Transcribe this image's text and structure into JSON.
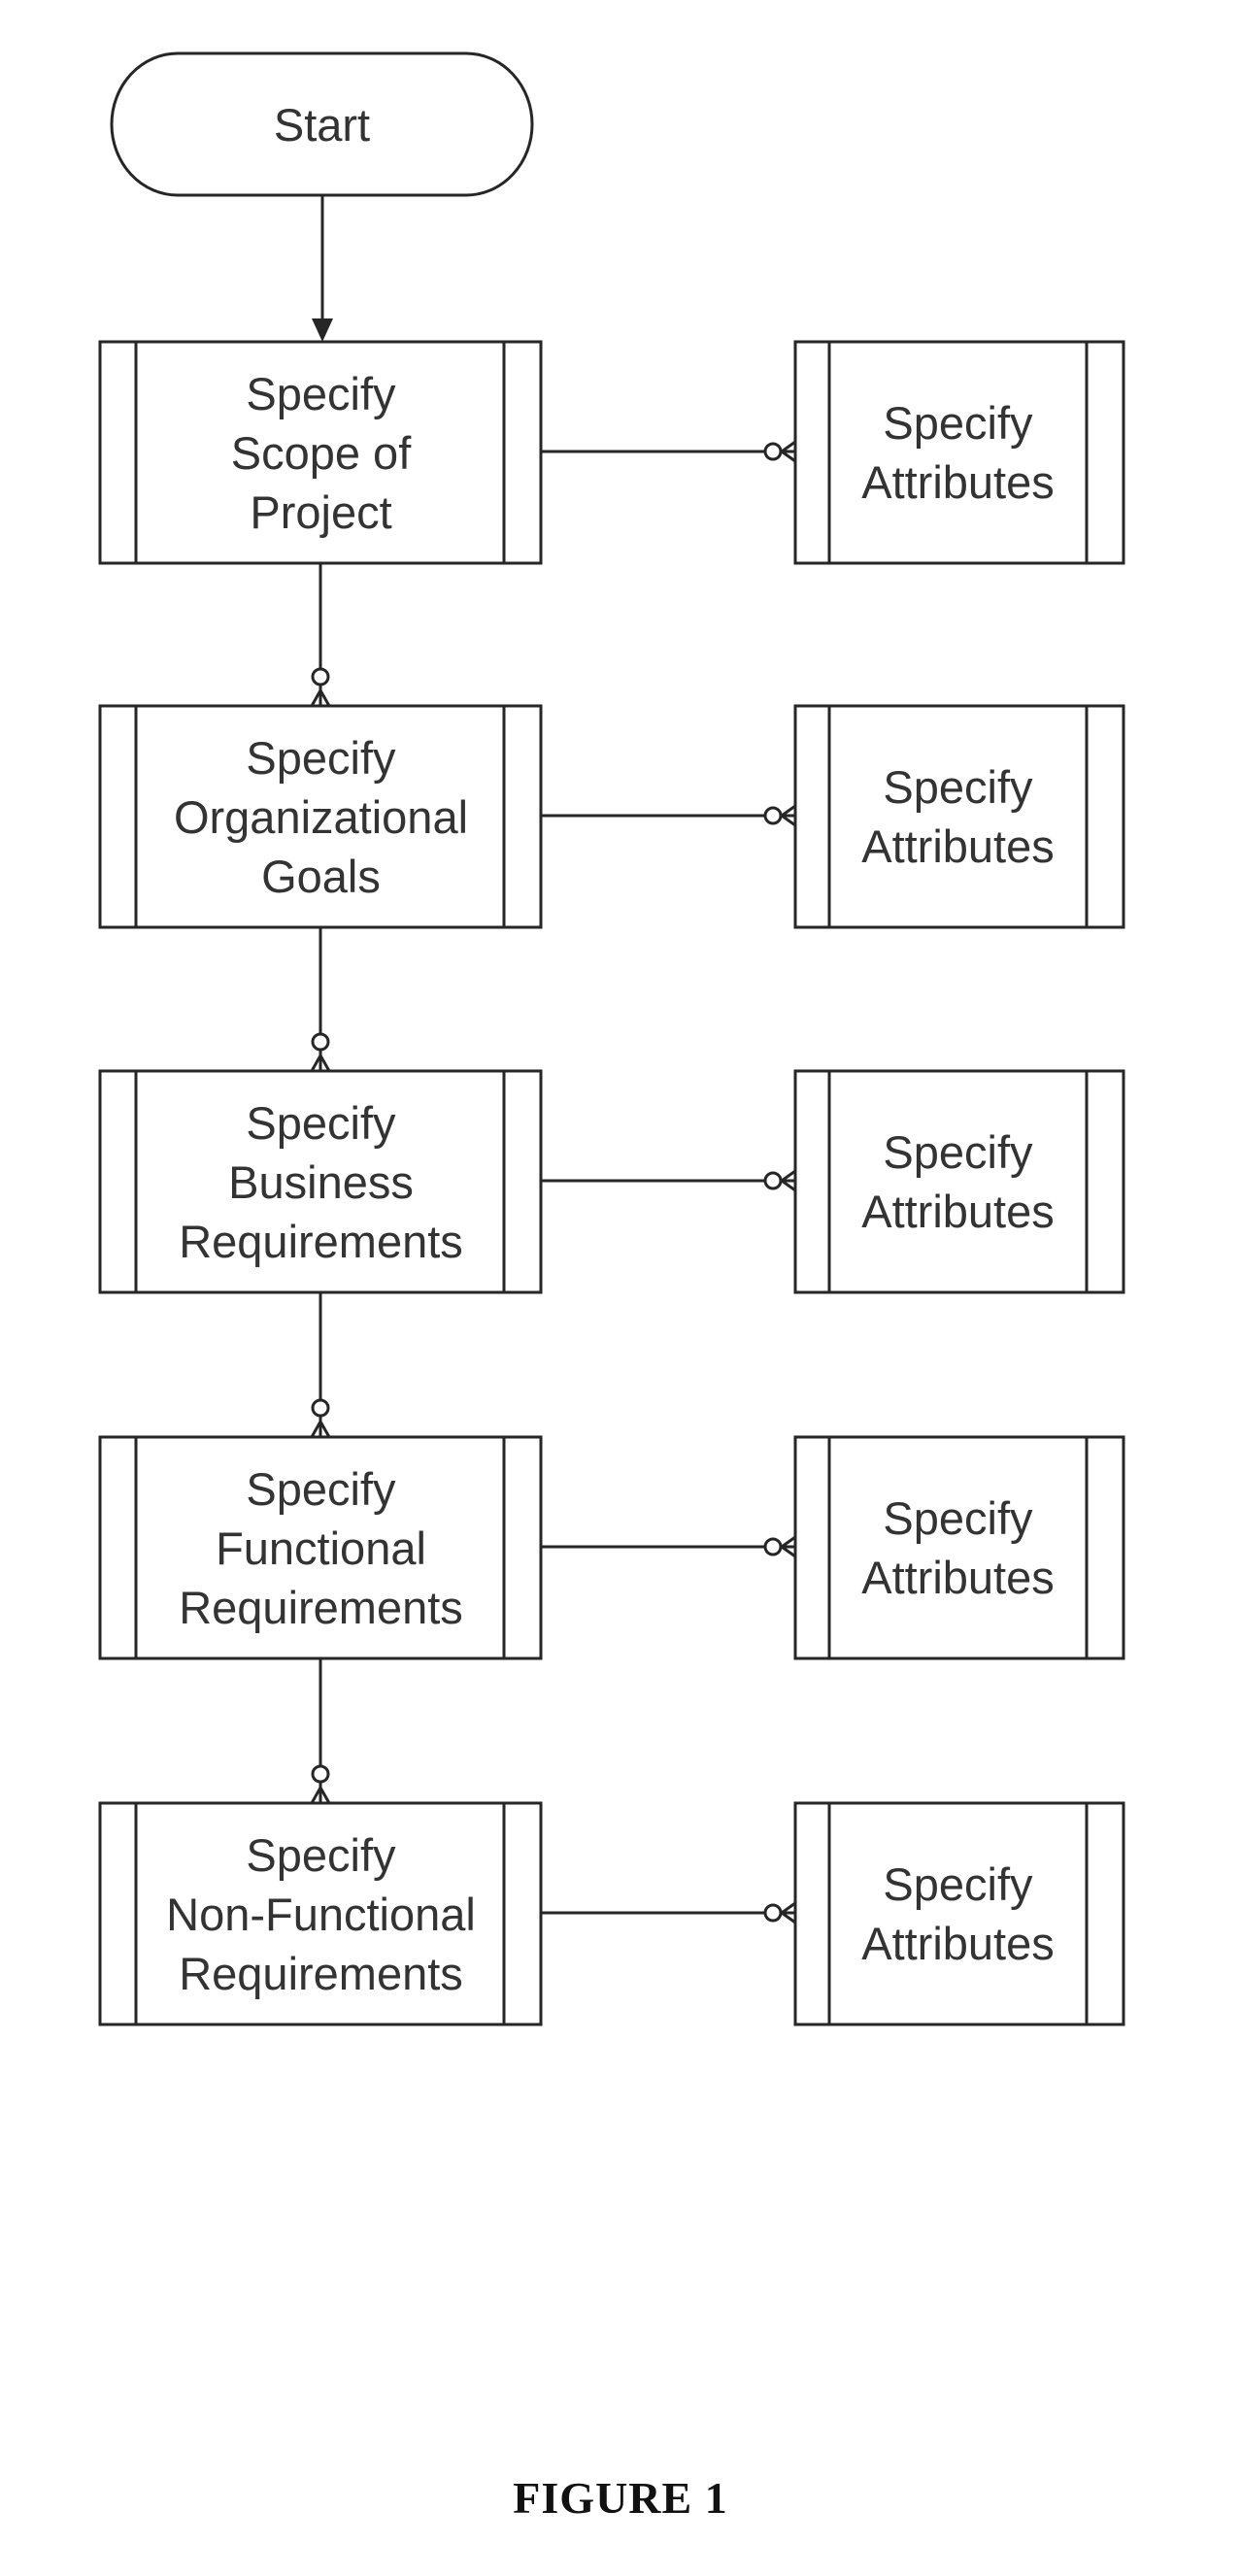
{
  "start": {
    "label": "Start"
  },
  "steps": [
    {
      "label": "Specify\nScope of\nProject",
      "attribute_label": "Specify\nAttributes"
    },
    {
      "label": "Specify\nOrganizational\nGoals",
      "attribute_label": "Specify\nAttributes"
    },
    {
      "label": "Specify\nBusiness\nRequirements",
      "attribute_label": "Specify\nAttributes"
    },
    {
      "label": "Specify\nFunctional\nRequirements",
      "attribute_label": "Specify\nAttributes"
    },
    {
      "label": "Specify\nNon-Functional\nRequirements",
      "attribute_label": "Specify\nAttributes"
    }
  ],
  "caption": "FIGURE 1"
}
